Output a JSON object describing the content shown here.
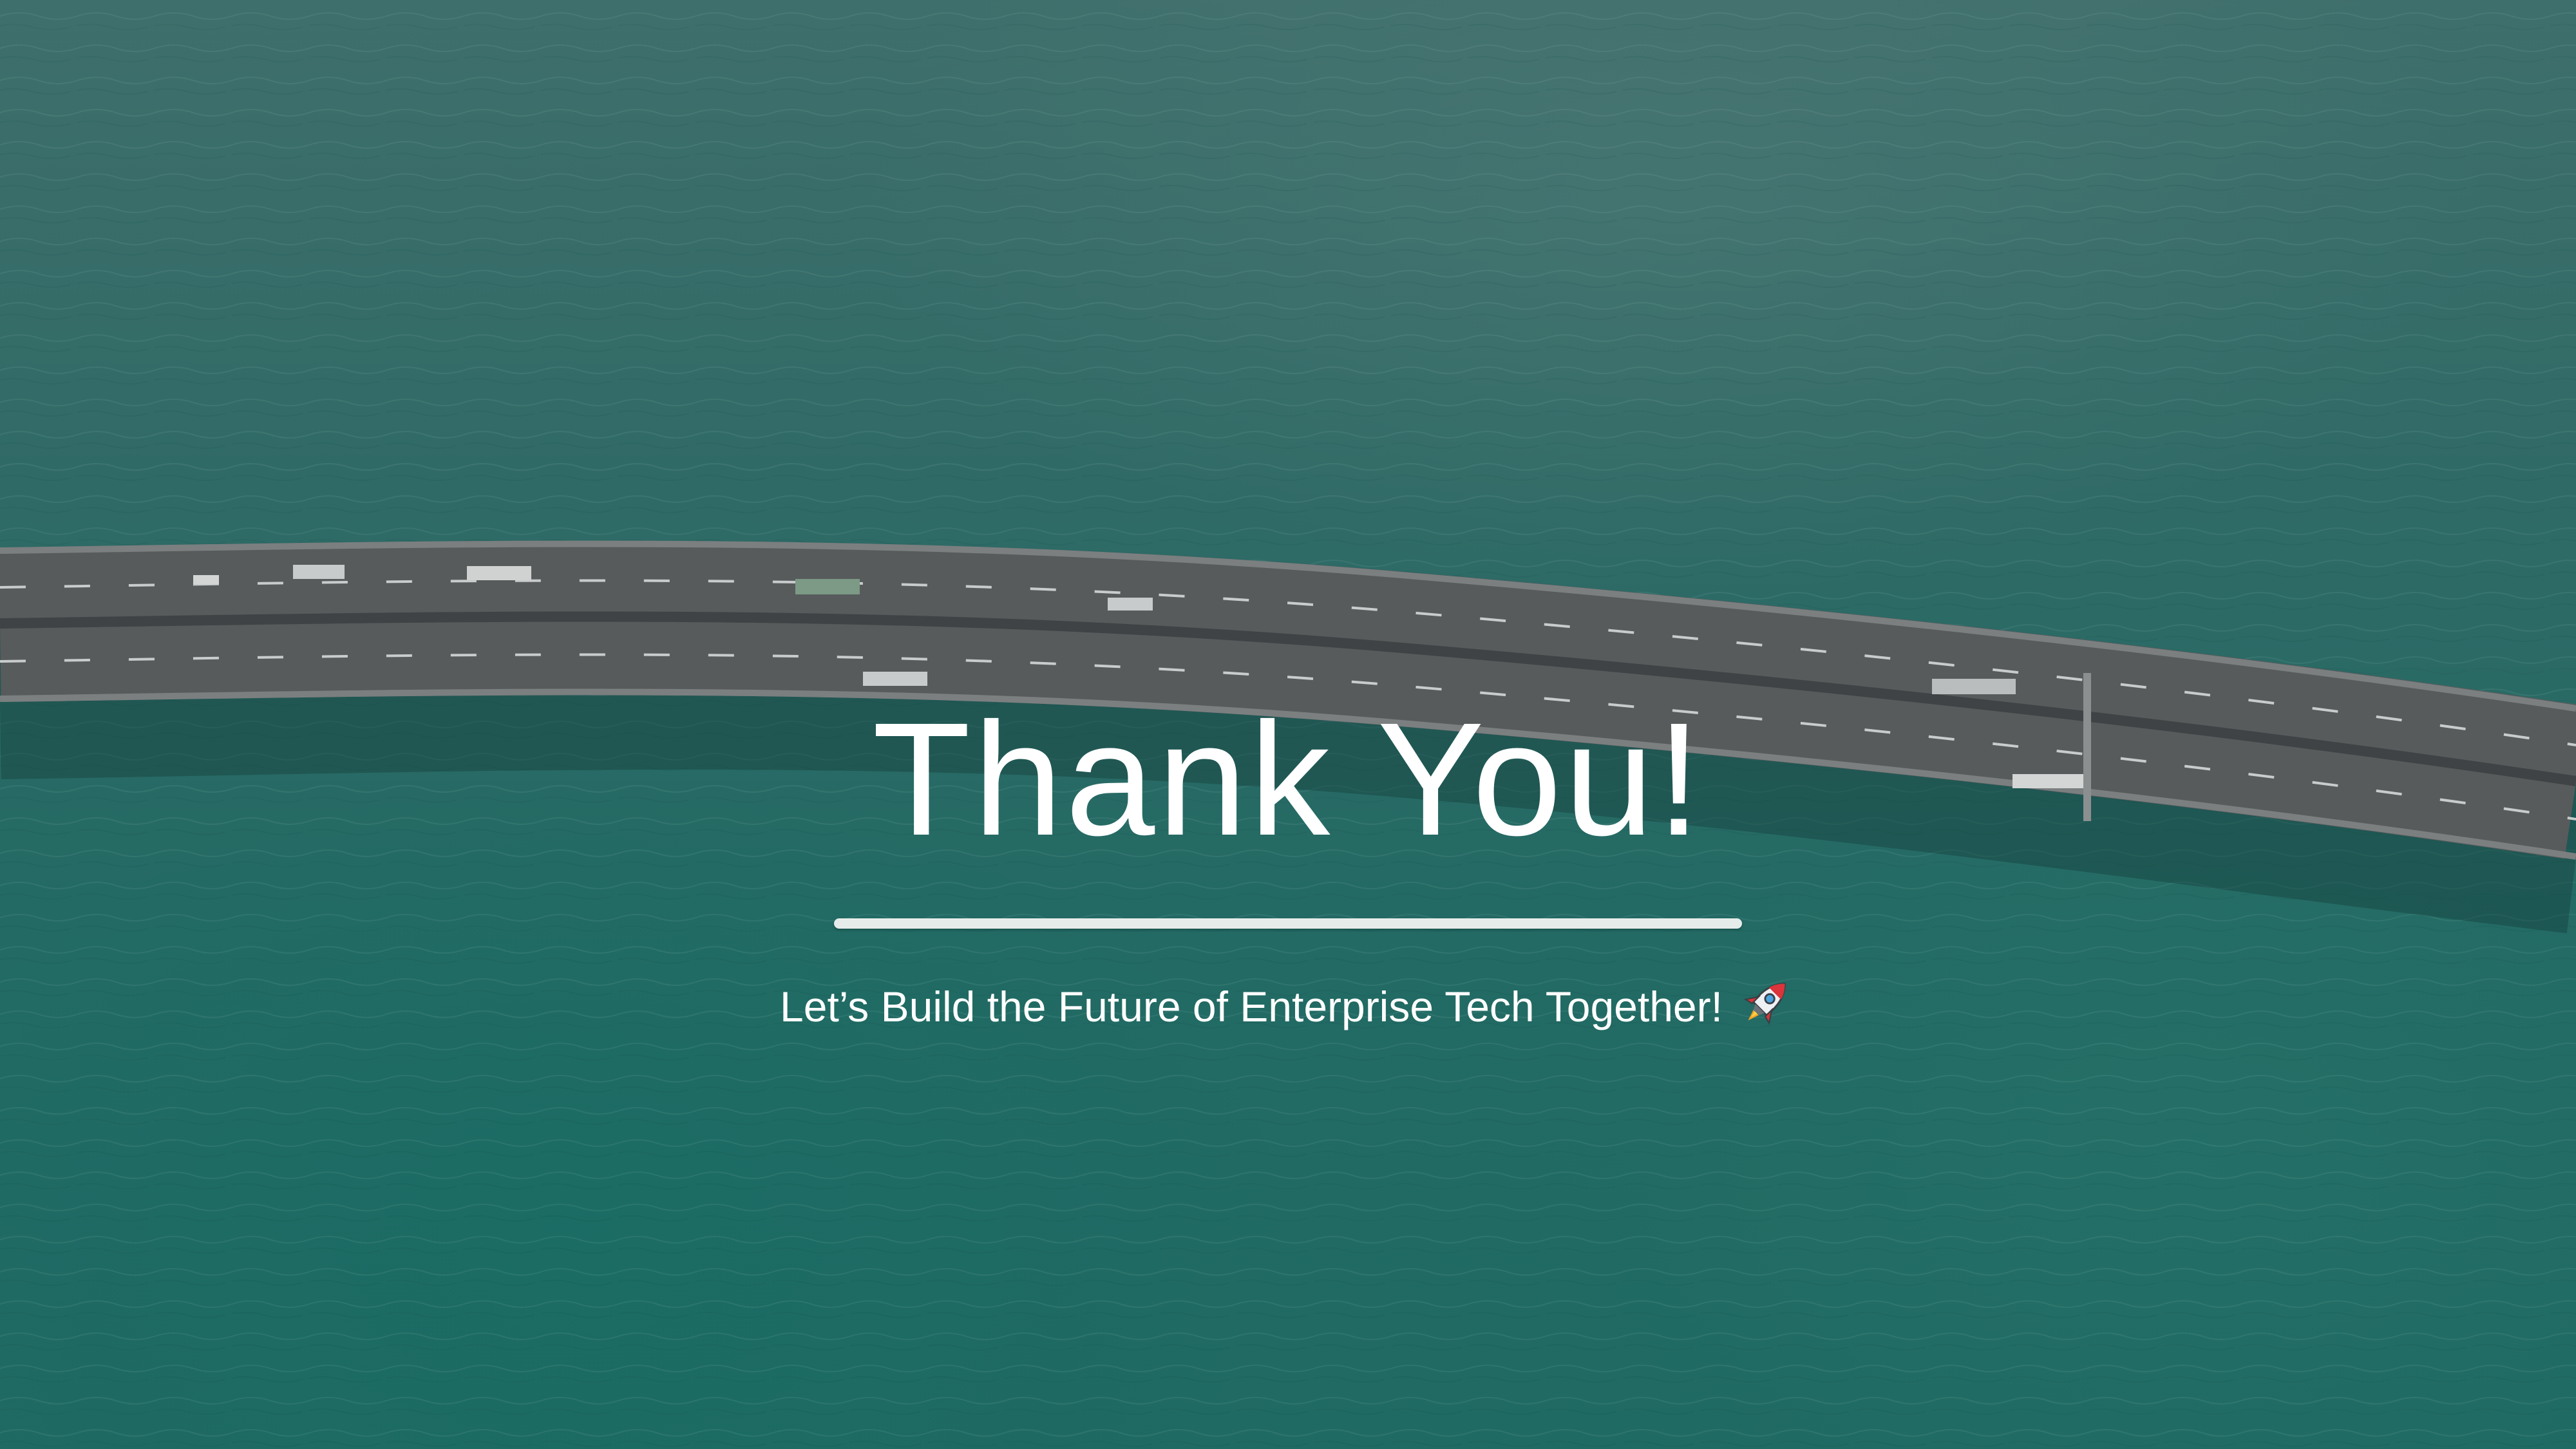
{
  "slide": {
    "title": "Thank You!",
    "subtitle": "Let’s Build the Future of Enterprise Tech Together!",
    "emoji_icon": "rocket-icon",
    "colors": {
      "text": "#ffffff",
      "divider": "#e6ecea",
      "water": "#1f6a63"
    }
  }
}
